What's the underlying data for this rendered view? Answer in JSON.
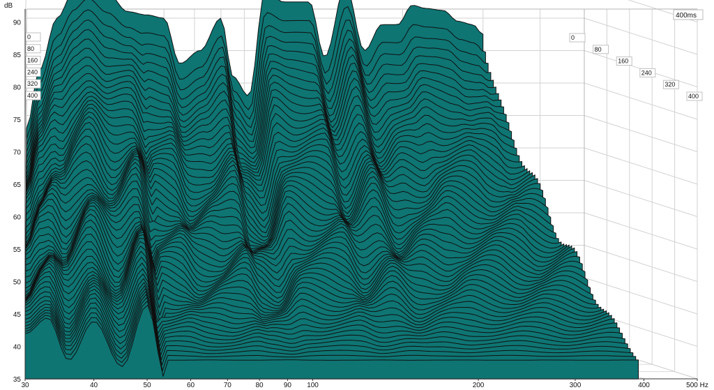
{
  "chart_data": {
    "type": "area",
    "title": "",
    "xlabel": "Hz",
    "ylabel": "dB",
    "zlabel": "400ms",
    "x_scale": "log",
    "xlim": [
      30,
      500
    ],
    "ylim": [
      35,
      92
    ],
    "zlim": [
      0,
      400
    ],
    "x_ticks": [
      30,
      40,
      50,
      60,
      70,
      80,
      90,
      100,
      200,
      300,
      400,
      500
    ],
    "x_tick_labels": [
      "30",
      "40",
      "50",
      "60",
      "70",
      "80",
      "90",
      "100",
      "200",
      "300",
      "400",
      "500 Hz"
    ],
    "y_ticks": [
      35,
      40,
      45,
      50,
      55,
      60,
      65,
      70,
      75,
      80,
      85,
      90
    ],
    "z_ticks": [
      0,
      80,
      160,
      240,
      320,
      400
    ],
    "grid": true,
    "fill_color": "#0e7573",
    "line_color": "#101010",
    "series_count": 60,
    "slice_interval_ms": 6.8,
    "series": [
      {
        "time_ms": 0,
        "x": [
          30,
          32,
          35,
          38,
          41,
          45,
          50,
          55,
          60,
          65,
          72,
          80,
          85,
          92,
          100,
          110,
          125,
          135,
          150,
          165,
          180,
          195,
          210,
          225,
          245,
          265,
          285,
          300
        ],
        "y": [
          68,
          77,
          85,
          89,
          90.8,
          89,
          86,
          85.5,
          85,
          78,
          80,
          85,
          76,
          73,
          89,
          87.5,
          87.5,
          79,
          90,
          80,
          84,
          84,
          87,
          86.5,
          86.2,
          84.5,
          84,
          82.5
        ]
      },
      {
        "time_ms": 400,
        "x": [
          30,
          33,
          36,
          40,
          45,
          50,
          54
        ],
        "y": [
          42,
          44.5,
          38,
          44,
          37,
          46.5,
          35
        ]
      }
    ]
  }
}
